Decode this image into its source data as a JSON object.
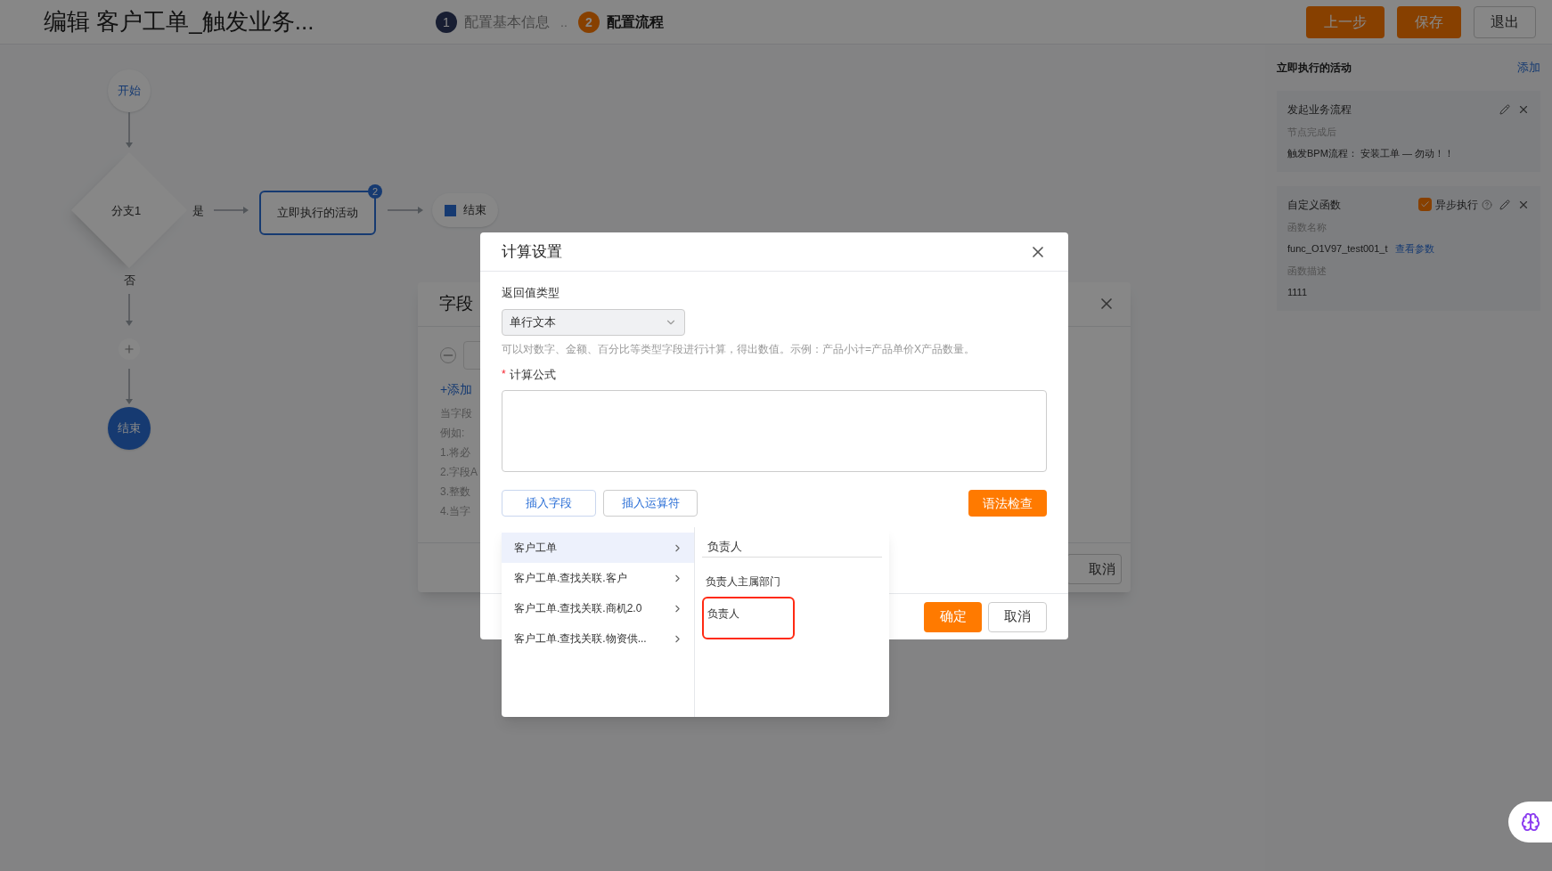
{
  "header": {
    "title": "编辑 客户工单_触发业务...",
    "steps": [
      {
        "number": "1",
        "label": "配置基本信息",
        "selected": false
      },
      {
        "number": "2",
        "label": "配置流程",
        "selected": true
      }
    ],
    "separator": "..",
    "buttons": [
      {
        "label": "上一步",
        "kind": "primary"
      },
      {
        "label": "保存",
        "kind": "primary"
      },
      {
        "label": "退出",
        "kind": "default"
      }
    ]
  },
  "flow": {
    "start": "开始",
    "branch": "分支1",
    "yes_label": "是",
    "no_label": "否",
    "activity": {
      "label": "立即执行的活动",
      "badge": "2",
      "selected": true
    },
    "end_right": "结束",
    "end_bottom": "结束"
  },
  "background_dialog": {
    "title": "字段",
    "add_link": "+添加",
    "lines": [
      "当字段",
      "例如:",
      "1.将必",
      "2.字段A",
      "3.整数",
      "4.当字"
    ],
    "cancel": "取消"
  },
  "side_panel": {
    "title": "立即执行的活动",
    "add": "添加",
    "cards": [
      {
        "title": "发起业务流程",
        "rows": [
          {
            "kind": "label",
            "text": "节点完成后"
          },
          {
            "kind": "value",
            "text": "触发BPM流程： 安装工单 — 勿动！！"
          }
        ]
      },
      {
        "title": "自定义函数",
        "async": {
          "label": "异步执行",
          "checked": true
        },
        "rows": [
          {
            "kind": "label",
            "text": "函数名称"
          },
          {
            "kind": "value",
            "text": "func_O1V97_test001_t",
            "link": "查看参数"
          },
          {
            "kind": "label",
            "text": "函数描述"
          },
          {
            "kind": "value",
            "text": "1111"
          }
        ]
      }
    ]
  },
  "modal": {
    "title": "计算设置",
    "return_label": "返回值类型",
    "return_value": "单行文本",
    "hint": "可以对数字、金额、百分比等类型字段进行计算，得出数值。示例：产品小计=产品单价X产品数量。",
    "formula_label": "计算公式",
    "required_mark": "*",
    "tool_buttons": [
      {
        "label": "插入字段",
        "selected": true
      },
      {
        "label": "插入运算符",
        "selected": false
      }
    ],
    "check_button": "语法检查",
    "ok": "确定",
    "cancel": "取消"
  },
  "popover": {
    "categories": [
      {
        "label": "客户工单",
        "selected": true
      },
      {
        "label": "客户工单.查找关联.客户",
        "selected": false
      },
      {
        "label": "客户工单.查找关联.商机2.0",
        "selected": false
      },
      {
        "label": "客户工单.查找关联.物资供...",
        "selected": false
      }
    ],
    "search": {
      "value": "负责人"
    },
    "fields": [
      {
        "label": "负责人主属部门",
        "highlighted": false
      },
      {
        "label": "负责人",
        "highlighted": true
      }
    ]
  }
}
